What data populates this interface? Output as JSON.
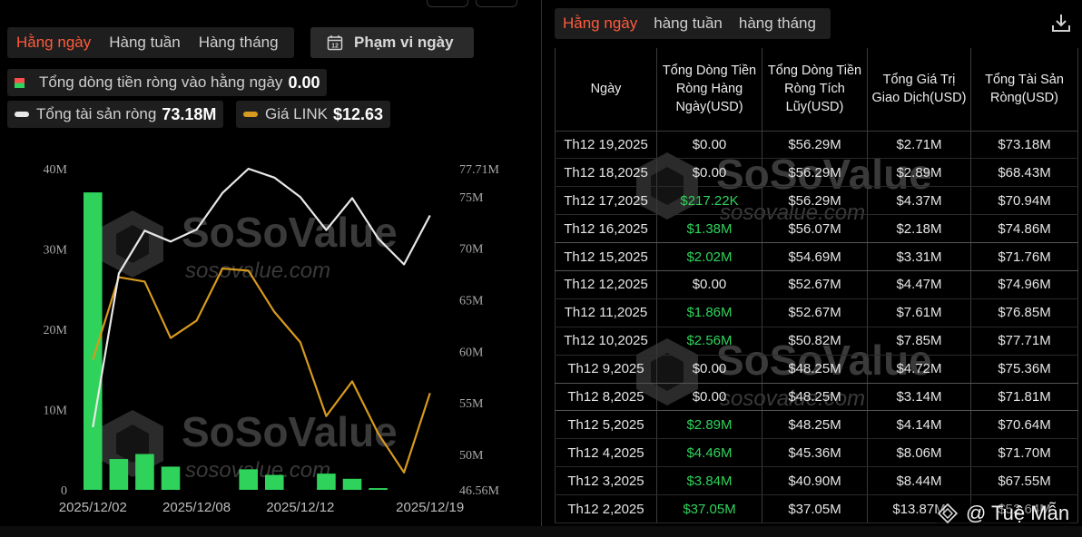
{
  "left": {
    "periods": [
      "Hằng ngày",
      "Hàng tuần",
      "Hàng tháng"
    ],
    "range_button": "Phạm vi ngày",
    "legend": {
      "flow_label": "Tổng dòng tiền ròng vào hằng ngày",
      "flow_value": "0.00",
      "assets_label": "Tổng tài sản ròng",
      "assets_value": "73.18M",
      "price_label": "Giá LINK",
      "price_value": "$12.63"
    },
    "watermark": {
      "brand": "SoSoValue",
      "site": "sosovalue.com"
    }
  },
  "chart_data": {
    "type": "bar",
    "title": "",
    "x": [
      "2025/12/02",
      "2025/12/03",
      "2025/12/04",
      "2025/12/05",
      "2025/12/08",
      "2025/12/09",
      "2025/12/10",
      "2025/12/11",
      "2025/12/12",
      "2025/12/15",
      "2025/12/16",
      "2025/12/17",
      "2025/12/18",
      "2025/12/19"
    ],
    "x_tick_labels": [
      "2025/12/02",
      "2025/12/08",
      "2025/12/12",
      "2025/12/19"
    ],
    "y_left": {
      "ticks": [
        "0",
        "10M",
        "20M",
        "30M",
        "40M"
      ],
      "ylim": [
        0,
        40000000
      ]
    },
    "y_right": {
      "ticks": [
        "46.56M",
        "50M",
        "55M",
        "60M",
        "65M",
        "70M",
        "75M",
        "77.71M"
      ],
      "ylim": [
        46560000,
        77710000
      ]
    },
    "series": [
      {
        "name": "Tổng dòng tiền ròng vào hằng ngày",
        "type": "bar",
        "axis": "left",
        "color": "#2fd35b",
        "values": [
          37050000,
          3840000,
          4460000,
          2890000,
          0,
          0,
          2560000,
          1860000,
          0,
          2020000,
          1380000,
          217220,
          0,
          0
        ]
      },
      {
        "name": "Tổng tài sản ròng",
        "type": "line",
        "axis": "right",
        "color": "#e8e8e8",
        "values": [
          52640000,
          67550000,
          71700000,
          70640000,
          71810000,
          75360000,
          77710000,
          76850000,
          74960000,
          71760000,
          74860000,
          70940000,
          68430000,
          73180000
        ]
      },
      {
        "name": "Giá LINK",
        "type": "line",
        "axis": "price",
        "color": "#d79a1e",
        "values": [
          13.4,
          15.3,
          15.2,
          13.9,
          14.3,
          15.5,
          15.45,
          14.5,
          13.8,
          12.1,
          12.9,
          11.7,
          10.8,
          12.63
        ]
      }
    ],
    "price_ylim": [
      10.4,
      17.8
    ],
    "grid": false,
    "legend": "top-left"
  },
  "right": {
    "periods": [
      "Hằng ngày",
      "hàng tuần",
      "hàng tháng"
    ],
    "headers": [
      "Ngày",
      "Tổng Dòng Tiền Ròng Hàng Ngày(USD)",
      "Tổng Dòng Tiền Ròng Tích Lũy(USD)",
      "Tổng Giá Trị Giao Dịch(USD)",
      "Tổng Tài Sản Ròng(USD)"
    ],
    "rows": [
      [
        "Th12 19,2025",
        "$0.00",
        "$56.29M",
        "$2.71M",
        "$73.18M"
      ],
      [
        "Th12 18,2025",
        "$0.00",
        "$56.29M",
        "$2.89M",
        "$68.43M"
      ],
      [
        "Th12 17,2025",
        "$217.22K",
        "$56.29M",
        "$4.37M",
        "$70.94M"
      ],
      [
        "Th12 16,2025",
        "$1.38M",
        "$56.07M",
        "$2.18M",
        "$74.86M"
      ],
      [
        "Th12 15,2025",
        "$2.02M",
        "$54.69M",
        "$3.31M",
        "$71.76M"
      ],
      [
        "Th12 12,2025",
        "$0.00",
        "$52.67M",
        "$4.47M",
        "$74.96M"
      ],
      [
        "Th12 11,2025",
        "$1.86M",
        "$52.67M",
        "$7.61M",
        "$76.85M"
      ],
      [
        "Th12 10,2025",
        "$2.56M",
        "$50.82M",
        "$7.85M",
        "$77.71M"
      ],
      [
        "Th12 9,2025",
        "$0.00",
        "$48.25M",
        "$4.72M",
        "$75.36M"
      ],
      [
        "Th12 8,2025",
        "$0.00",
        "$48.25M",
        "$3.14M",
        "$71.81M"
      ],
      [
        "Th12 5,2025",
        "$2.89M",
        "$48.25M",
        "$4.14M",
        "$70.64M"
      ],
      [
        "Th12 4,2025",
        "$4.46M",
        "$45.36M",
        "$8.06M",
        "$71.70M"
      ],
      [
        "Th12 3,2025",
        "$3.84M",
        "$40.90M",
        "$8.44M",
        "$67.55M"
      ],
      [
        "Th12 2,2025",
        "$37.05M",
        "$37.05M",
        "$13.87M",
        "$52.64M"
      ]
    ],
    "green_rows": [
      2,
      3,
      4,
      6,
      7,
      10,
      11,
      12,
      13
    ]
  },
  "credit": "@ Tuệ Mẫn",
  "colors": {
    "accent": "#ff5a3a",
    "green": "#2fd35b",
    "gold": "#d79a1e",
    "white_line": "#e8e8e8"
  }
}
